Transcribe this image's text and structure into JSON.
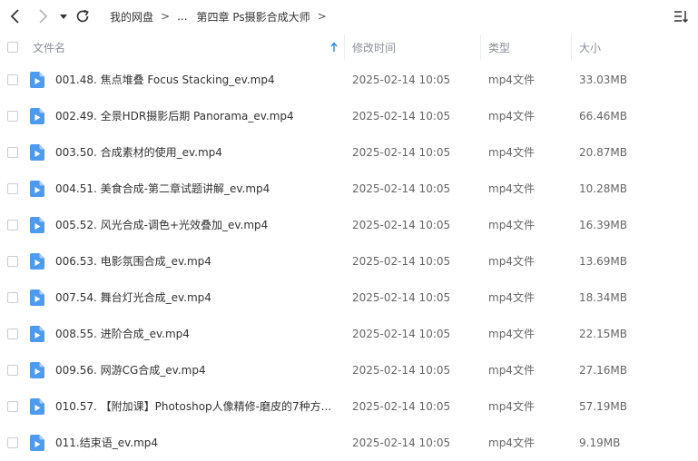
{
  "toolbar": {
    "back_icon": "chevron-left-icon",
    "forward_icon": "chevron-right-icon",
    "dropdown_icon": "caret-down-icon",
    "refresh_icon": "refresh-icon",
    "sort_toggle_icon": "sort-list-icon"
  },
  "breadcrumb": {
    "root": "我的网盘",
    "ellipsis": "...",
    "current": "第四章 Ps摄影合成大师",
    "separator": ">"
  },
  "columns": {
    "name": "文件名",
    "modified": "修改时间",
    "type": "类型",
    "size": "大小"
  },
  "colors": {
    "file_icon": "#4c9bf1",
    "sort_arrow": "#1e8ef5",
    "header_text": "#8a8f99"
  },
  "files": [
    {
      "name": "001.48. 焦点堆叠 Focus Stacking_ev.mp4",
      "modified": "2025-02-14 10:05",
      "type": "mp4文件",
      "size": "33.03MB"
    },
    {
      "name": "002.49. 全景HDR摄影后期 Panorama_ev.mp4",
      "modified": "2025-02-14 10:05",
      "type": "mp4文件",
      "size": "66.46MB"
    },
    {
      "name": "003.50. 合成素材的使用_ev.mp4",
      "modified": "2025-02-14 10:05",
      "type": "mp4文件",
      "size": "20.87MB"
    },
    {
      "name": "004.51. 美食合成-第二章试题讲解_ev.mp4",
      "modified": "2025-02-14 10:05",
      "type": "mp4文件",
      "size": "10.28MB"
    },
    {
      "name": "005.52. 风光合成-调色+光效叠加_ev.mp4",
      "modified": "2025-02-14 10:05",
      "type": "mp4文件",
      "size": "16.39MB"
    },
    {
      "name": "006.53. 电影氛围合成_ev.mp4",
      "modified": "2025-02-14 10:05",
      "type": "mp4文件",
      "size": "13.69MB"
    },
    {
      "name": "007.54. 舞台灯光合成_ev.mp4",
      "modified": "2025-02-14 10:05",
      "type": "mp4文件",
      "size": "18.34MB"
    },
    {
      "name": "008.55. 进阶合成_ev.mp4",
      "modified": "2025-02-14 10:05",
      "type": "mp4文件",
      "size": "22.15MB"
    },
    {
      "name": "009.56. 网游CG合成_ev.mp4",
      "modified": "2025-02-14 10:05",
      "type": "mp4文件",
      "size": "27.16MB"
    },
    {
      "name": "010.57. 【附加课】Photoshop人像精修-磨皮的7种方...",
      "modified": "2025-02-14 10:05",
      "type": "mp4文件",
      "size": "57.19MB"
    },
    {
      "name": "011.结束语_ev.mp4",
      "modified": "2025-02-14 10:05",
      "type": "mp4文件",
      "size": "9.19MB"
    }
  ]
}
